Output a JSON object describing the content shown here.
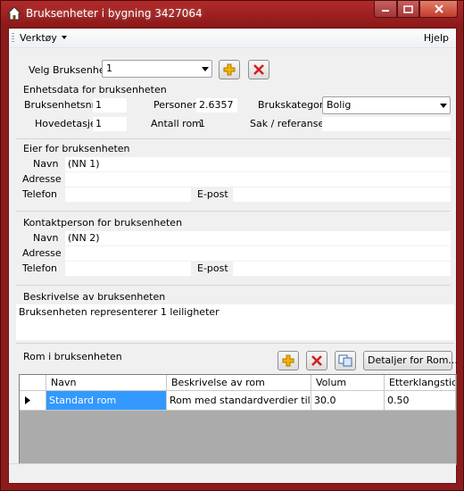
{
  "window": {
    "title": "Bruksenheter i bygning 3427064"
  },
  "menu": {
    "tools": "Verktøy",
    "help": "Hjelp"
  },
  "selector": {
    "label": "Velg Bruksenhet",
    "value": "1"
  },
  "unit_data": {
    "title": "Enhetsdata for bruksenheten",
    "unit_no_label": "Bruksenhetsnr.",
    "unit_no": "1",
    "persons_label": "Personer",
    "persons": "2.6357",
    "category_label": "Brukskategori",
    "category": "Bolig",
    "floor_label": "Hovedetasje",
    "floor": "1",
    "rooms_label": "Antall rom",
    "rooms": "1",
    "case_label": "Sak / referanse",
    "case": ""
  },
  "owner": {
    "title": "Eier for bruksenheten",
    "name_label": "Navn",
    "name": "(NN 1)",
    "address_label": "Adresse",
    "address": "",
    "phone_label": "Telefon",
    "phone": "",
    "email_label": "E-post",
    "email": ""
  },
  "contact": {
    "title": "Kontaktperson for bruksenheten",
    "name_label": "Navn",
    "name": "(NN 2)",
    "address_label": "Adresse",
    "address": "",
    "phone_label": "Telefon",
    "phone": "",
    "email_label": "E-post",
    "email": ""
  },
  "description": {
    "title": "Beskrivelse av bruksenheten",
    "text": "Bruksenheten representerer 1 leiligheter"
  },
  "rooms": {
    "title": "Rom i bruksenheten",
    "details_button": "Detaljer for Rom...",
    "columns": [
      "Navn",
      "Beskrivelse av rom",
      "Volum",
      "Etterklangstid"
    ],
    "rows": [
      {
        "name": "Standard rom",
        "description": "Rom med standardverdier tilsv...",
        "volume": "30.0",
        "reverb": "0.50"
      }
    ]
  },
  "colors": {
    "titlebar": "#9b2020",
    "selection": "#3399ff",
    "add": "#f2b400",
    "delete": "#d42020"
  }
}
